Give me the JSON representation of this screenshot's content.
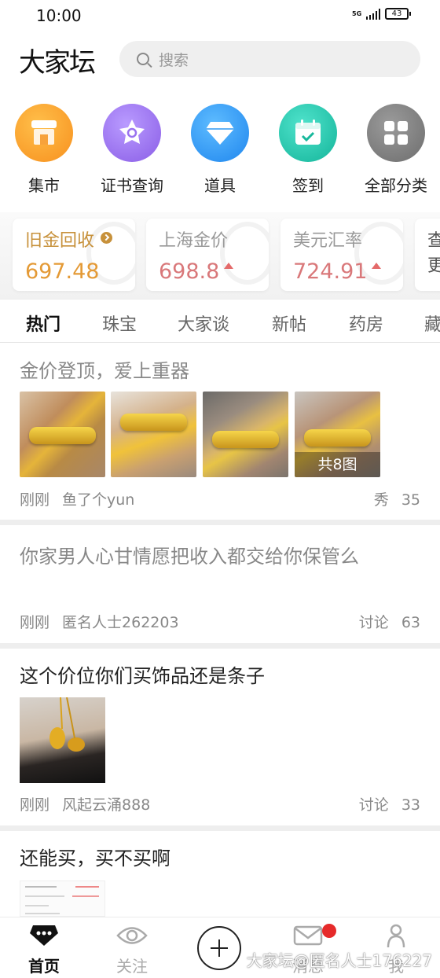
{
  "status_bar": {
    "time": "10:00",
    "network": "5G",
    "battery": "43"
  },
  "header": {
    "logo": "大家坛",
    "search_placeholder": "搜索"
  },
  "categories": [
    {
      "label": "集市",
      "icon": "shop-icon",
      "color": "#f7901e"
    },
    {
      "label": "证书查询",
      "icon": "certificate-search-icon",
      "color": "#8a5de6"
    },
    {
      "label": "道具",
      "icon": "diamond-icon",
      "color": "#1f86ee"
    },
    {
      "label": "签到",
      "icon": "calendar-checkin-icon",
      "color": "#14b59a"
    },
    {
      "label": "全部分类",
      "icon": "grid-icon",
      "color": "#6d6d6d"
    }
  ],
  "prices": [
    {
      "title": "旧金回收",
      "value": "697.48",
      "trend": ""
    },
    {
      "title": "上海金价",
      "value": "698.8",
      "trend": "up"
    },
    {
      "title": "美元汇率",
      "value": "724.91",
      "trend": "up"
    },
    {
      "title_line1": "查",
      "title_line2": "更"
    }
  ],
  "tabs": [
    "热门",
    "珠宝",
    "大家谈",
    "新帖",
    "药房",
    "藏"
  ],
  "posts": [
    {
      "title": "金价登顶，爱上重器",
      "time": "刚刚",
      "author": "鱼了个yun",
      "category": "秀",
      "count": "35",
      "image_count": "共8图"
    },
    {
      "title": "你家男人心甘情愿把收入都交给你保管么",
      "time": "刚刚",
      "author": "匿名人士262203",
      "category": "讨论",
      "count": "63"
    },
    {
      "title": "这个价位你们买饰品还是条子",
      "time": "刚刚",
      "author": "风起云涌888",
      "category": "讨论",
      "count": "33"
    },
    {
      "title": "还能买，买不买啊"
    }
  ],
  "bottom_nav": {
    "home": "首页",
    "follow": "关注",
    "messages": "消息",
    "me": "我"
  },
  "watermark": "大家坛@匿名人士176227"
}
